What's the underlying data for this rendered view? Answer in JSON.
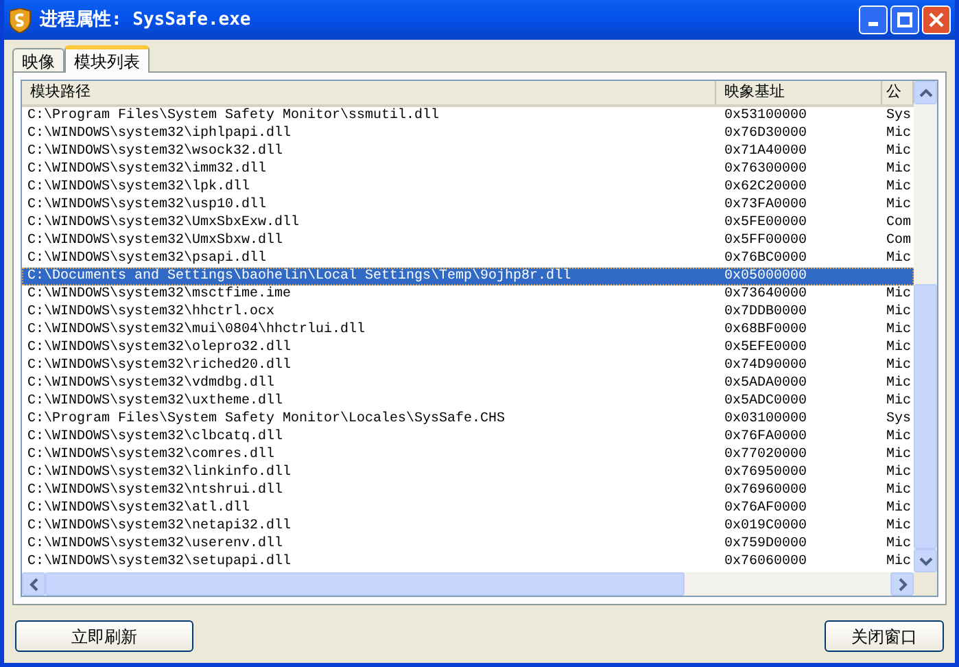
{
  "window": {
    "title": "进程属性: SysSafe.exe"
  },
  "tabs": [
    {
      "label": "映像",
      "selected": false
    },
    {
      "label": "模块列表",
      "selected": true
    }
  ],
  "table": {
    "columns": [
      "模块路径",
      "映象基址",
      "公"
    ],
    "rows": [
      {
        "path": "C:\\Program Files\\System Safety Monitor\\ssmutil.dll",
        "base": "0x53100000",
        "column_3": "Sys",
        "selected": false
      },
      {
        "path": "C:\\WINDOWS\\system32\\iphlpapi.dll",
        "base": "0x76D30000",
        "column_3": "Mic",
        "selected": false
      },
      {
        "path": "C:\\WINDOWS\\system32\\wsock32.dll",
        "base": "0x71A40000",
        "column_3": "Mic",
        "selected": false
      },
      {
        "path": "C:\\WINDOWS\\system32\\imm32.dll",
        "base": "0x76300000",
        "column_3": "Mic",
        "selected": false
      },
      {
        "path": "C:\\WINDOWS\\system32\\lpk.dll",
        "base": "0x62C20000",
        "column_3": "Mic",
        "selected": false
      },
      {
        "path": "C:\\WINDOWS\\system32\\usp10.dll",
        "base": "0x73FA0000",
        "column_3": "Mic",
        "selected": false
      },
      {
        "path": "C:\\WINDOWS\\system32\\UmxSbxExw.dll",
        "base": "0x5FE00000",
        "column_3": "Com",
        "selected": false
      },
      {
        "path": "C:\\WINDOWS\\system32\\UmxSbxw.dll",
        "base": "0x5FF00000",
        "column_3": "Com",
        "selected": false
      },
      {
        "path": "C:\\WINDOWS\\system32\\psapi.dll",
        "base": "0x76BC0000",
        "column_3": "Mic",
        "selected": false
      },
      {
        "path": "C:\\Documents and Settings\\baohelin\\Local Settings\\Temp\\9ojhp8r.dll",
        "base": "0x05000000",
        "selected": true
      },
      {
        "path": "C:\\WINDOWS\\system32\\msctfime.ime",
        "base": "0x73640000",
        "column_3": "Mic",
        "selected": false
      },
      {
        "path": "C:\\WINDOWS\\system32\\hhctrl.ocx",
        "base": "0x7DDB0000",
        "column_3": "Mic",
        "selected": false
      },
      {
        "path": "C:\\WINDOWS\\system32\\mui\\0804\\hhctrlui.dll",
        "base": "0x68BF0000",
        "column_3": "Mic",
        "selected": false
      },
      {
        "path": "C:\\WINDOWS\\system32\\olepro32.dll",
        "base": "0x5EFE0000",
        "column_3": "Mic",
        "selected": false
      },
      {
        "path": "C:\\WINDOWS\\system32\\riched20.dll",
        "base": "0x74D90000",
        "column_3": "Mic",
        "selected": false
      },
      {
        "path": "C:\\WINDOWS\\system32\\vdmdbg.dll",
        "base": "0x5ADA0000",
        "column_3": "Mic",
        "selected": false
      },
      {
        "path": "C:\\WINDOWS\\system32\\uxtheme.dll",
        "base": "0x5ADC0000",
        "column_3": "Mic",
        "selected": false
      },
      {
        "path": "C:\\Program Files\\System Safety Monitor\\Locales\\SysSafe.CHS",
        "base": "0x03100000",
        "column_3": "Sys",
        "selected": false
      },
      {
        "path": "C:\\WINDOWS\\system32\\clbcatq.dll",
        "base": "0x76FA0000",
        "column_3": "Mic",
        "selected": false
      },
      {
        "path": "C:\\WINDOWS\\system32\\comres.dll",
        "base": "0x77020000",
        "column_3": "Mic",
        "selected": false
      },
      {
        "path": "C:\\WINDOWS\\system32\\linkinfo.dll",
        "base": "0x76950000",
        "column_3": "Mic",
        "selected": false
      },
      {
        "path": "C:\\WINDOWS\\system32\\ntshrui.dll",
        "base": "0x76960000",
        "column_3": "Mic",
        "selected": false
      },
      {
        "path": "C:\\WINDOWS\\system32\\atl.dll",
        "base": "0x76AF0000",
        "column_3": "Mic",
        "selected": false
      },
      {
        "path": "C:\\WINDOWS\\system32\\netapi32.dll",
        "base": "0x019C0000",
        "column_3": "Mic",
        "selected": false
      },
      {
        "path": "C:\\WINDOWS\\system32\\userenv.dll",
        "base": "0x759D0000",
        "column_3": "Mic",
        "selected": false
      },
      {
        "path": "C:\\WINDOWS\\system32\\setupapi.dll",
        "base": "0x76060000",
        "column_3": "Mic",
        "selected": false
      }
    ]
  },
  "buttons": [
    "立即刷新",
    "关闭窗口"
  ]
}
